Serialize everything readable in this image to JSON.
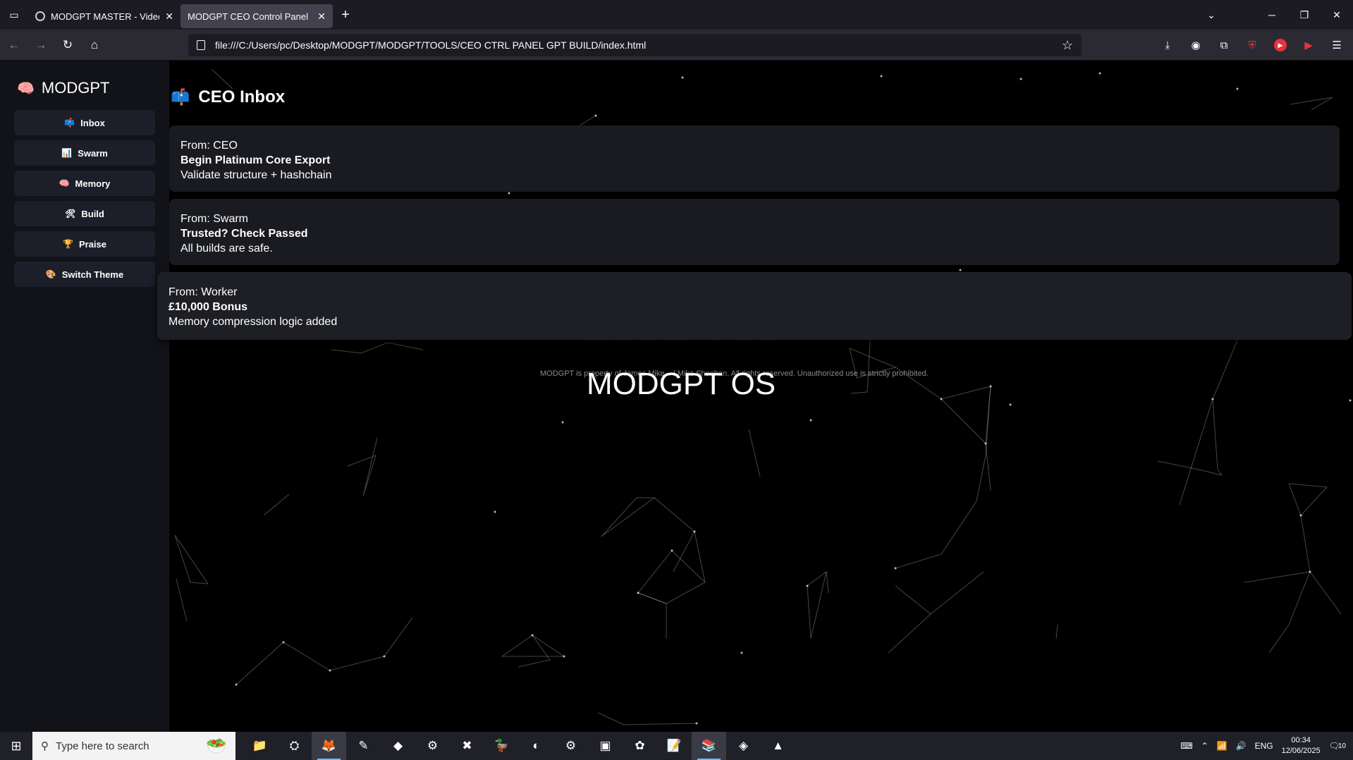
{
  "browser": {
    "tabs": [
      {
        "title": "MODGPT MASTER - Video not a",
        "active": false
      },
      {
        "title": "MODGPT CEO Control Panel",
        "active": true
      }
    ],
    "url": "file:///C:/Users/pc/Desktop/MODGPT/MODGPT/TOOLS/CEO CTRL PANEL GPT BUILD/index.html",
    "new_tab": "+"
  },
  "sidebar": {
    "brand": "MODGPT",
    "brand_icon": "🧠",
    "items": [
      {
        "icon": "📫",
        "label": "Inbox"
      },
      {
        "icon": "📊",
        "label": "Swarm"
      },
      {
        "icon": "🧠",
        "label": "Memory"
      },
      {
        "icon": "🛠",
        "label": "Build"
      },
      {
        "icon": "🏆",
        "label": "Praise"
      },
      {
        "icon": "🎨",
        "label": "Switch Theme"
      }
    ]
  },
  "main": {
    "title_icon": "📫",
    "title": "CEO Inbox",
    "messages": [
      {
        "from": "From: CEO",
        "subject": "Begin Platinum Core Export",
        "body": "Validate structure + hashchain"
      },
      {
        "from": "From: Swarm",
        "subject": "Trusted? Check Passed",
        "body": "All builds are safe."
      },
      {
        "from": "From: Worker",
        "subject": "£10,000 Bonus",
        "body": "Memory compression logic added"
      }
    ],
    "ghost_title": "MODGPT OS",
    "os_title": "MODGPT OS",
    "copyright": "MODGPT is property of James Mike... / Mike Sheehan. All rights reserved. Unauthorized use is strictly prohibited."
  },
  "taskbar": {
    "search_placeholder": "Type here to search",
    "language": "ENG",
    "time": "00:34",
    "date": "12/06/2025",
    "notifications": "10"
  }
}
